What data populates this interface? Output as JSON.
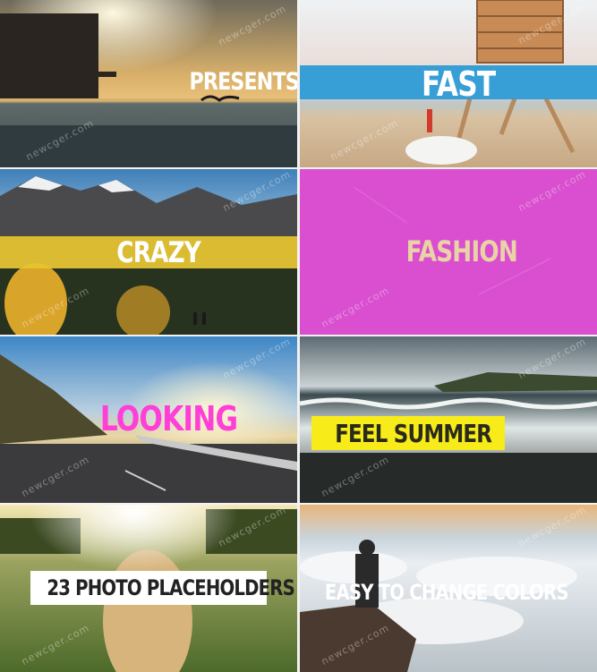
{
  "watermark": "newcger.com",
  "tiles": [
    {
      "caption": "PRESENTS"
    },
    {
      "caption": "FAST",
      "band_color": "#2e9bd6"
    },
    {
      "caption": "CRAZY",
      "band_color": "#e6c430"
    },
    {
      "caption": "FASHION",
      "bg_color": "#d94fcf"
    },
    {
      "caption": "LOOKING",
      "text_color": "#ff3fd6"
    },
    {
      "caption": "FEEL SUMMER",
      "box_color": "#f7ec1a"
    },
    {
      "caption": "23 PHOTO PLACEHOLDERS"
    },
    {
      "caption": "EASY TO CHANGE COLORS"
    }
  ]
}
